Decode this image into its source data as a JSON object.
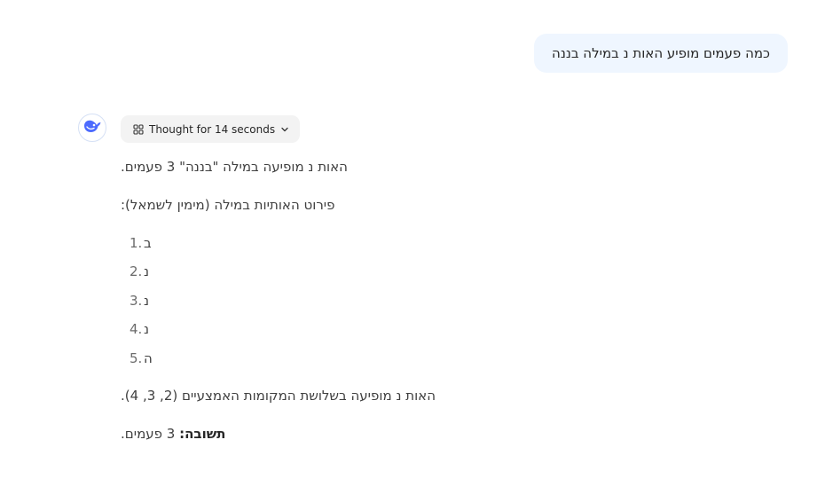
{
  "user_message": {
    "text": "כמה פעמים מופיע האות נ במילה בננה"
  },
  "assistant": {
    "avatar_icon": "deepseek-whale-icon",
    "thought_chip": {
      "label": "Thought for 14 seconds",
      "icon": "sparkle-grid-icon",
      "chevron": "chevron-down-icon"
    },
    "paragraph_1": "האות נ מופיעה במילה \"בננה\" 3 פעמים.",
    "paragraph_2": "פירוט האותיות במילה (מימין לשמאל):",
    "list": [
      {
        "num": "1.",
        "letter": "ב"
      },
      {
        "num": "2.",
        "letter": "נ"
      },
      {
        "num": "3.",
        "letter": "נ"
      },
      {
        "num": "4.",
        "letter": "נ"
      },
      {
        "num": "5.",
        "letter": "ה"
      }
    ],
    "paragraph_3": "האות נ מופיעה בשלושת המקומות האמצעיים (2, 3, 4).",
    "answer_label": "תשובה:",
    "answer_value": "3 פעמים."
  },
  "colors": {
    "user_bubble_bg": "#eff6ff",
    "chip_bg": "#f3f3f3",
    "brand_blue": "#4d6bfe"
  }
}
